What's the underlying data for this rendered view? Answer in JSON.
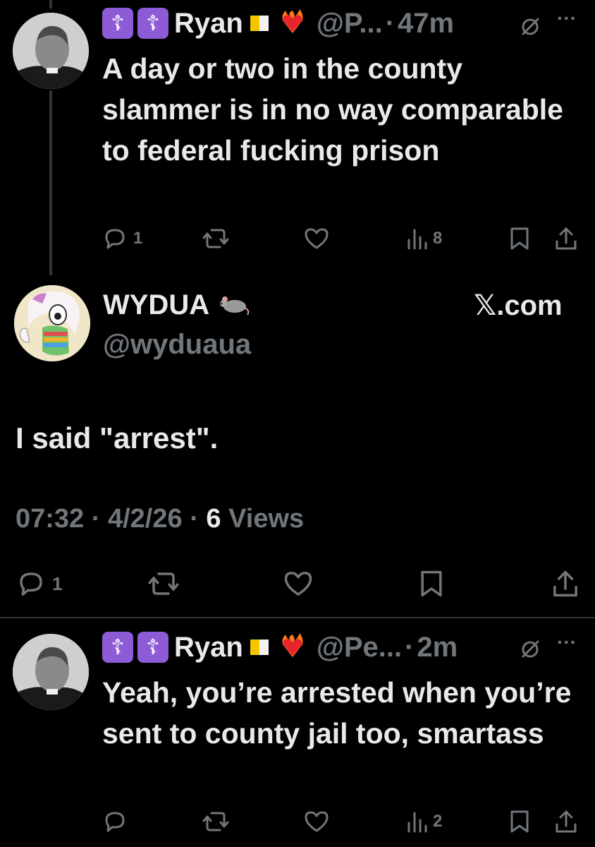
{
  "reply_top": {
    "badges": [
      "☦",
      "☦"
    ],
    "name": "Ryan",
    "handle": "@P...",
    "time": "47m",
    "separator": "·",
    "text": "A day or two in the county slammer is in no way comparable to federal fucking prison",
    "actions": {
      "replies": "1",
      "views": "8"
    }
  },
  "main_tweet": {
    "name": "WYDUA",
    "handle": "@wyduaua",
    "source_label": "𝕏.com",
    "text": "I said \"arrest\".",
    "meta": {
      "time": "07:32",
      "date": "4/2/26",
      "separator": "·",
      "views_count": "6",
      "views_label": "Views"
    },
    "actions": {
      "replies": "1"
    }
  },
  "reply_bottom": {
    "badges": [
      "☦",
      "☦"
    ],
    "name": "Ryan",
    "handle": "@Pe...",
    "time": "2m",
    "separator": "·",
    "text": "Yeah, you’re arrested when you’re sent to county jail too, smartass",
    "actions": {
      "views": "2"
    }
  },
  "icons": {
    "more": "···",
    "rat": "🐀"
  },
  "colors": {
    "background": "#000000",
    "text": "#e7e9ea",
    "muted": "#71767b",
    "badge": "#8e5bd6",
    "divider": "#2f3336"
  }
}
